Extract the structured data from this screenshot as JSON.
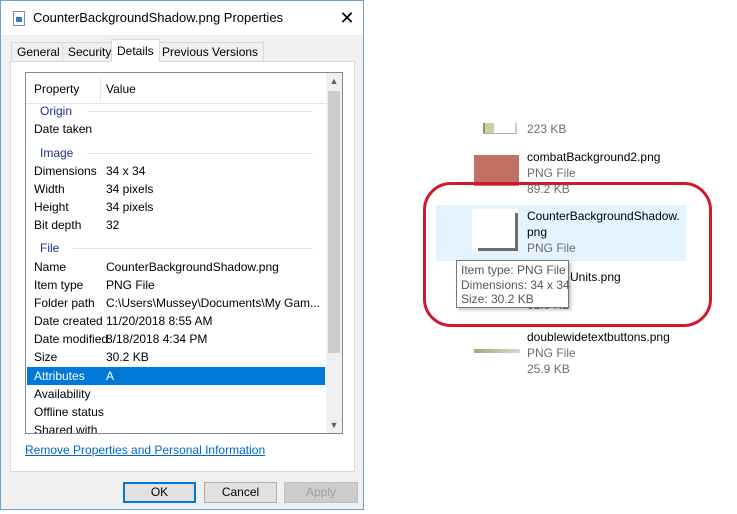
{
  "dialog": {
    "title": "CounterBackgroundShadow.png Properties",
    "close_glyph": "✕",
    "tabs": [
      "General",
      "Security",
      "Details",
      "Previous Versions"
    ],
    "active_tab": "Details",
    "header": {
      "property": "Property",
      "value": "Value"
    },
    "groups": {
      "origin": "Origin",
      "image": "Image",
      "file": "File"
    },
    "rows": {
      "date_taken": {
        "k": "Date taken",
        "v": ""
      },
      "dimensions": {
        "k": "Dimensions",
        "v": "34 x 34"
      },
      "width": {
        "k": "Width",
        "v": "34 pixels"
      },
      "height": {
        "k": "Height",
        "v": "34 pixels"
      },
      "bit_depth": {
        "k": "Bit depth",
        "v": "32"
      },
      "name": {
        "k": "Name",
        "v": "CounterBackgroundShadow.png"
      },
      "item_type": {
        "k": "Item type",
        "v": "PNG File"
      },
      "folder_path": {
        "k": "Folder path",
        "v": "C:\\Users\\Mussey\\Documents\\My Gam..."
      },
      "date_created": {
        "k": "Date created",
        "v": "11/20/2018 8:55 AM"
      },
      "date_modified": {
        "k": "Date modified",
        "v": "8/18/2018 4:34 PM"
      },
      "size": {
        "k": "Size",
        "v": "30.2 KB"
      },
      "attributes": {
        "k": "Attributes",
        "v": "A"
      },
      "availability": {
        "k": "Availability",
        "v": ""
      },
      "offline_status": {
        "k": "Offline status",
        "v": ""
      },
      "shared_with": {
        "k": "Shared with",
        "v": ""
      }
    },
    "remove_link": "Remove Properties and Personal Information",
    "buttons": {
      "ok": "OK",
      "cancel": "Cancel",
      "apply": "Apply"
    }
  },
  "files": {
    "top_size": "223 KB",
    "combat": {
      "name": "combatBackground2.png",
      "type": "PNG File",
      "size": "89.2 KB"
    },
    "shadow": {
      "name_line1": "CounterBackgroundShadow.",
      "name_line2": "png",
      "type": "PNG File"
    },
    "units": {
      "name_tail": "Units.png",
      "size_tail": "31.0 KB"
    },
    "doublewide": {
      "name": "doublewidetextbuttons.png",
      "type": "PNG File",
      "size": "25.9 KB"
    }
  },
  "tooltip": {
    "item_type": "Item type: PNG File",
    "dimensions": "Dimensions: 34 x 34",
    "size": "Size: 30.2 KB"
  },
  "colors": {
    "annotation": "#d0192b",
    "accent": "#0078d7",
    "hover": "#e5f3ff"
  }
}
